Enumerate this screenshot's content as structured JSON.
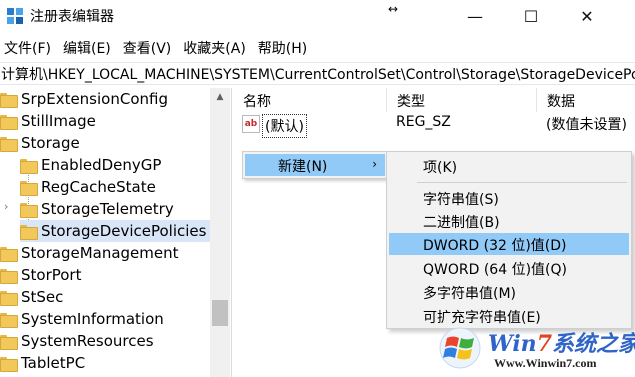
{
  "window": {
    "title": "注册表编辑器",
    "resize_glyph": "↔",
    "minimize_glyph": "—",
    "maximize_glyph": "☐",
    "close_glyph": "✕"
  },
  "menubar": {
    "items": [
      "文件(F)",
      "编辑(E)",
      "查看(V)",
      "收藏夹(A)",
      "帮助(H)"
    ]
  },
  "address": {
    "path": "计算机\\HKEY_LOCAL_MACHINE\\SYSTEM\\CurrentControlSet\\Control\\Storage\\StorageDevicePolicies"
  },
  "tree": {
    "items": [
      {
        "label": "SrpExtensionConfig",
        "level": 0
      },
      {
        "label": "StillImage",
        "level": 0
      },
      {
        "label": "Storage",
        "level": 0,
        "expanded": true
      },
      {
        "label": "EnabledDenyGP",
        "level": 1
      },
      {
        "label": "RegCacheState",
        "level": 1
      },
      {
        "label": "StorageTelemetry",
        "level": 1,
        "has_children": true
      },
      {
        "label": "StorageDevicePolicies",
        "level": 1,
        "selected": true
      },
      {
        "label": "StorageManagement",
        "level": 0
      },
      {
        "label": "StorPort",
        "level": 0
      },
      {
        "label": "StSec",
        "level": 0
      },
      {
        "label": "SystemInformation",
        "level": 0
      },
      {
        "label": "SystemResources",
        "level": 0
      },
      {
        "label": "TabletPC",
        "level": 0
      }
    ],
    "expander_glyph": "›",
    "scroll_up_glyph": "▲"
  },
  "values": {
    "headers": {
      "name": "名称",
      "type": "类型",
      "data": "数据"
    },
    "rows": [
      {
        "icon": "ab",
        "name": "(默认)",
        "type": "REG_SZ",
        "data": "(数值未设置)"
      }
    ]
  },
  "context_menu": {
    "item": "新建(N)",
    "arrow": "›"
  },
  "submenu": {
    "items": [
      {
        "label": "项(K)"
      },
      {
        "label": "字符串值(S)"
      },
      {
        "label": "二进制值(B)"
      },
      {
        "label": "DWORD (32 位)值(D)",
        "highlighted": true
      },
      {
        "label": "QWORD (64 位)值(Q)"
      },
      {
        "label": "多字符串值(M)"
      },
      {
        "label": "可扩充字符串值(E)"
      }
    ]
  },
  "watermark": {
    "brand_prefix": "Win",
    "brand_number": "7",
    "brand_suffix": "系统之家",
    "url": "Www.Winwin7.com"
  },
  "colors": {
    "highlight": "#91c9f7",
    "menu_bg": "#f2f2f2",
    "folder": "#f3c85a",
    "selection": "#d9e6f7"
  }
}
